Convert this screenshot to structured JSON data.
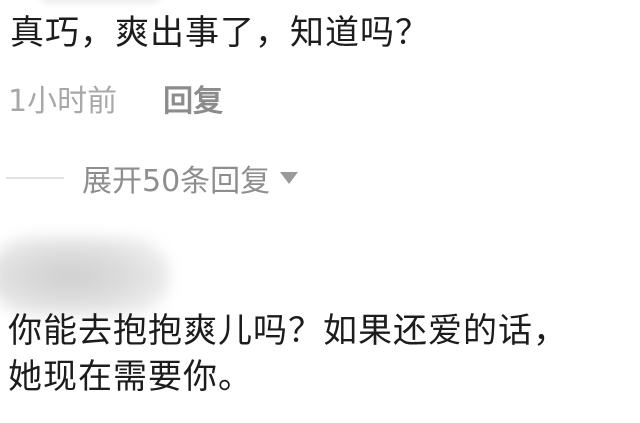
{
  "comment": {
    "text": "真巧，爽出事了，知道吗？",
    "time": "1小时前",
    "reply_label": "回复"
  },
  "replies": {
    "expand_label": "展开50条回复",
    "expand_icon": "triangle-down-icon"
  },
  "second_comment": {
    "line1": "你能去抱抱爽儿吗？如果还爱的话，",
    "line2": "她现在需要你。"
  }
}
